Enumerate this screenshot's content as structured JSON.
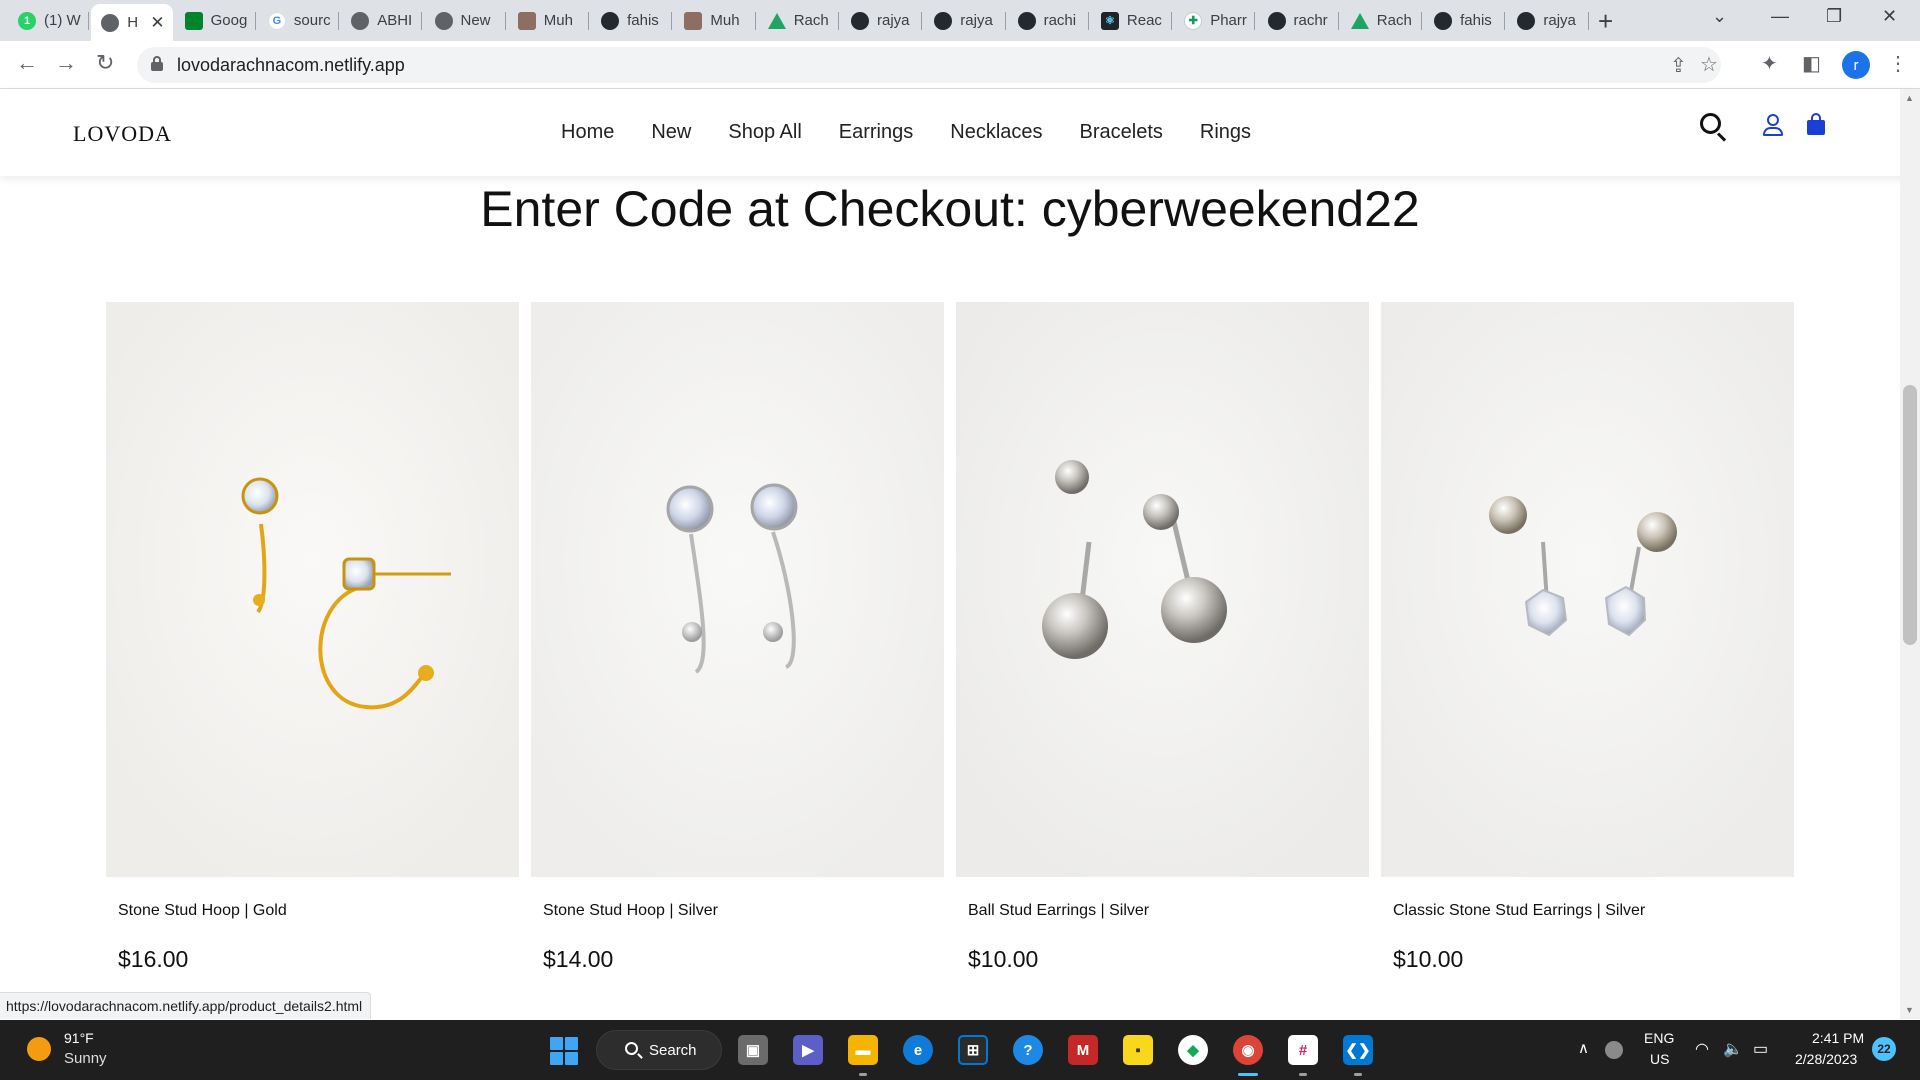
{
  "browser": {
    "tabs": [
      {
        "title": "(1) W",
        "icon": "whatsapp-icon",
        "fav": "wa",
        "glyph": "1"
      },
      {
        "title": "H",
        "icon": "globe-icon",
        "fav": "globe",
        "glyph": "",
        "active": true
      },
      {
        "title": "Goog",
        "icon": "google-meet-icon",
        "fav": "meet",
        "glyph": ""
      },
      {
        "title": "sourc",
        "icon": "google-icon",
        "fav": "g",
        "glyph": "G"
      },
      {
        "title": "ABHI",
        "icon": "globe-icon",
        "fav": "globe",
        "glyph": ""
      },
      {
        "title": "New",
        "icon": "globe-icon",
        "fav": "globe",
        "glyph": ""
      },
      {
        "title": "Muh",
        "icon": "profile-photo-icon",
        "fav": "photo",
        "glyph": ""
      },
      {
        "title": "fahis",
        "icon": "github-icon",
        "fav": "gh",
        "glyph": ""
      },
      {
        "title": "Muh",
        "icon": "profile-photo-icon",
        "fav": "photo",
        "glyph": ""
      },
      {
        "title": "Rach",
        "icon": "google-drive-icon",
        "fav": "drive",
        "glyph": ""
      },
      {
        "title": "rajya",
        "icon": "github-icon",
        "fav": "gh",
        "glyph": ""
      },
      {
        "title": "rajya",
        "icon": "github-icon",
        "fav": "gh",
        "glyph": ""
      },
      {
        "title": "rachi",
        "icon": "github-icon",
        "fav": "gh",
        "glyph": ""
      },
      {
        "title": "Reac",
        "icon": "react-icon",
        "fav": "react",
        "glyph": "⚛"
      },
      {
        "title": "Pharr",
        "icon": "pharmacy-icon",
        "fav": "pharm",
        "glyph": "✚"
      },
      {
        "title": "rachr",
        "icon": "github-icon",
        "fav": "gh",
        "glyph": ""
      },
      {
        "title": "Rach",
        "icon": "google-drive-icon",
        "fav": "drive",
        "glyph": ""
      },
      {
        "title": "fahis",
        "icon": "github-icon",
        "fav": "gh",
        "glyph": ""
      },
      {
        "title": "rajya",
        "icon": "github-icon",
        "fav": "gh",
        "glyph": ""
      }
    ],
    "url": "lovodarachnacom.netlify.app",
    "profile_initial": "r",
    "status_url": "https://lovodarachnacom.netlify.app/product_details2.html"
  },
  "site": {
    "logo": "LOVODA",
    "nav": [
      "Home",
      "New",
      "Shop All",
      "Earrings",
      "Necklaces",
      "Bracelets",
      "Rings"
    ],
    "promo": "Enter Code at Checkout: cyberweekend22",
    "accent_color": "#1a3fd6",
    "products": [
      {
        "name": "Stone Stud Hoop | Gold",
        "price": "$16.00",
        "metal": "gold"
      },
      {
        "name": "Stone Stud Hoop | Silver",
        "price": "$14.00",
        "metal": "silver"
      },
      {
        "name": "Ball Stud Earrings | Silver",
        "price": "$10.00",
        "metal": "silver"
      },
      {
        "name": "Classic Stone Stud Earrings | Silver",
        "price": "$10.00",
        "metal": "silver"
      }
    ]
  },
  "taskbar": {
    "weather_temp": "91°F",
    "weather_condition": "Sunny",
    "search_label": "Search",
    "lang_line1": "ENG",
    "lang_line2": "US",
    "time": "2:41 PM",
    "date": "2/28/2023",
    "notification_count": "22"
  }
}
